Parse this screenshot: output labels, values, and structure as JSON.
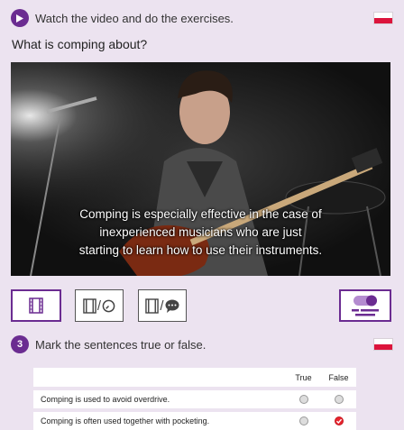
{
  "step1": {
    "number_icon": "play-icon",
    "text": "Watch the video and do the exercises."
  },
  "question": "What is comping about?",
  "video": {
    "subtitle_lines": [
      "Comping is especially effective in the case of",
      "inexperienced musicians who are just",
      "starting to learn how to use their instruments."
    ]
  },
  "controls": {
    "video_time_sep": "/",
    "video_chat_sep": "/"
  },
  "step3": {
    "number": "3",
    "text": "Mark the sentences true or false."
  },
  "table": {
    "headers": {
      "true": "True",
      "false": "False"
    },
    "rows": [
      {
        "text": "Comping is used to avoid overdrive.",
        "selected": null
      },
      {
        "text": "Comping is often used together with pocketing.",
        "selected": "false"
      }
    ]
  },
  "colors": {
    "accent": "#6b2c91",
    "page_bg": "#ece3f0",
    "checked": "#e8242e"
  }
}
